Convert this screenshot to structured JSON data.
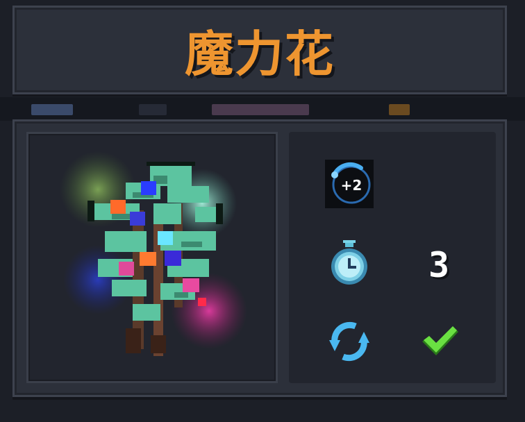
{
  "item": {
    "name": "魔力花",
    "name_color": "#ee9530"
  },
  "stats": {
    "mana_bonus_badge": "+2",
    "mana_icon": "mana-plus-icon",
    "cooldown_icon": "stopwatch-icon",
    "cooldown_value": "3",
    "refresh_icon": "refresh-arrows-icon",
    "check_icon": "checkmark-icon"
  },
  "art": {
    "icon": "magic-flower-sprite"
  }
}
